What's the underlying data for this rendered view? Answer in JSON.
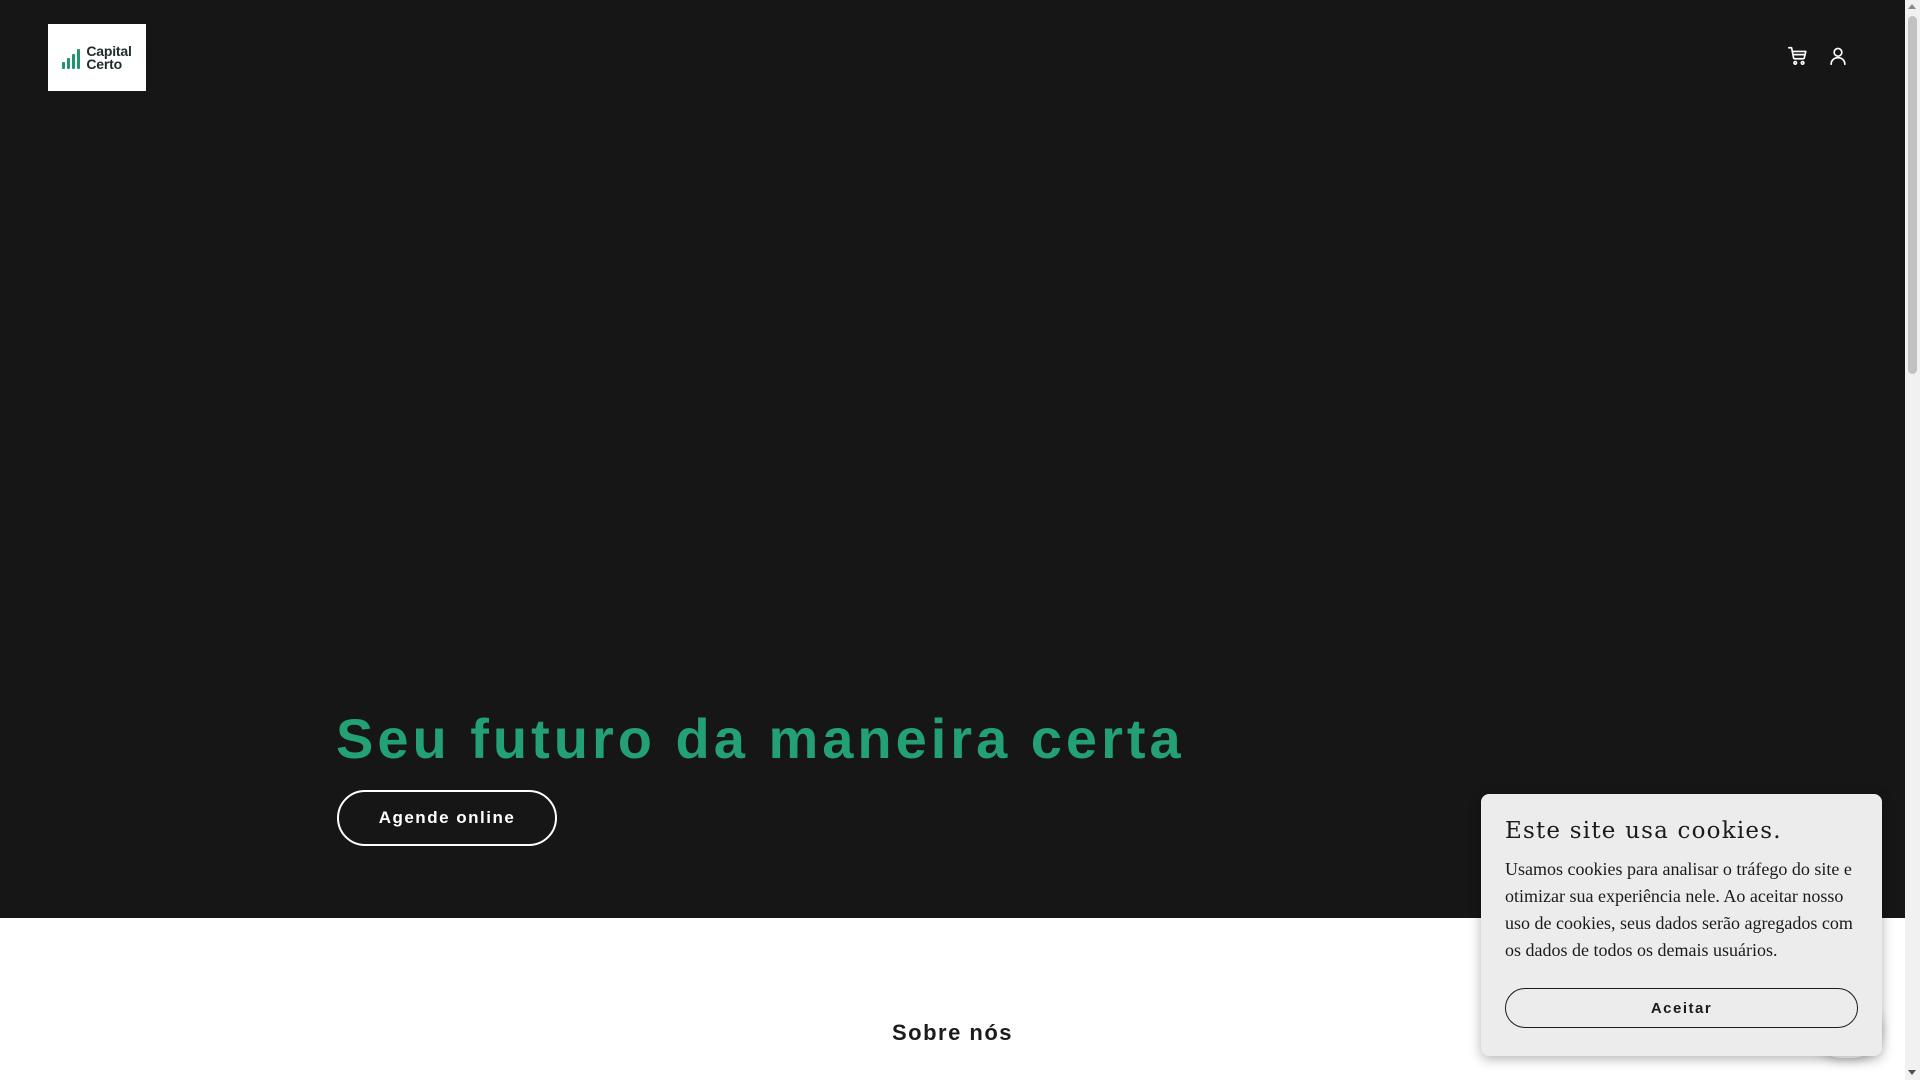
{
  "header": {
    "logo": {
      "line1": "Capital",
      "line2": "Certo",
      "icon": "bar-chart-icon",
      "color": "#22956a"
    },
    "icons": [
      "cart-icon",
      "user-icon"
    ]
  },
  "hero": {
    "title": "Seu futuro da maneira certa",
    "cta_label": "Agende online",
    "background": "#161616",
    "title_color": "#23a074"
  },
  "about": {
    "heading": "Sobre nós"
  },
  "cookie_banner": {
    "title": "Este site usa cookies.",
    "text": "Usamos cookies para analisar o tráfego do site e otimizar sua experiência nele. Ao aceitar nosso uso de cookies, seus dados serão agregados com os dados de todos os demais usuários.",
    "accept_label": "Aceitar"
  }
}
